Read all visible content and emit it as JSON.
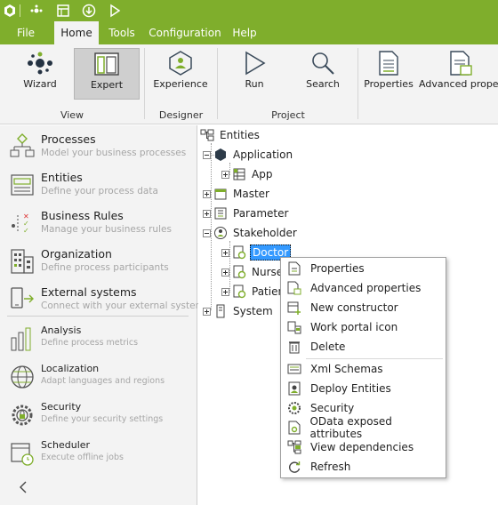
{
  "menu": {
    "tabs": [
      "File",
      "Home",
      "Tools",
      "Configuration",
      "Help"
    ],
    "active": "Home"
  },
  "ribbon": {
    "buttons": [
      "Wizard",
      "Expert",
      "Experience",
      "Run",
      "Search",
      "Properties",
      "Advanced propert"
    ],
    "groups": [
      "View",
      "Designer",
      "Project"
    ]
  },
  "sidebar": {
    "items": [
      {
        "title": "Processes",
        "subtitle": "Model your business processes"
      },
      {
        "title": "Entities",
        "subtitle": "Define your process data"
      },
      {
        "title": "Business Rules",
        "subtitle": "Manage your business rules"
      },
      {
        "title": "Organization",
        "subtitle": "Define process participants"
      },
      {
        "title": "External systems",
        "subtitle": "Connect with your external systems"
      },
      {
        "title": "Analysis",
        "subtitle": "Define process metrics"
      },
      {
        "title": "Localization",
        "subtitle": "Adapt languages and regions"
      },
      {
        "title": "Security",
        "subtitle": "Define your security settings"
      },
      {
        "title": "Scheduler",
        "subtitle": "Execute offline jobs"
      }
    ]
  },
  "tree": {
    "root": "Entities",
    "nodes": [
      "Application",
      "App",
      "Master",
      "Parameter",
      "Stakeholder",
      "Doctor",
      "Nurse",
      "Patient",
      "System"
    ],
    "selected": "Doctor"
  },
  "context_menu": {
    "items": [
      "Properties",
      "Advanced properties",
      "New constructor",
      "Work portal icon",
      "Delete",
      "Xml Schemas",
      "Deploy Entities",
      "Security",
      "OData exposed attributes",
      "View dependencies",
      "Refresh"
    ]
  },
  "colors": {
    "accent": "#7fae2c",
    "selection": "#3399ff"
  }
}
